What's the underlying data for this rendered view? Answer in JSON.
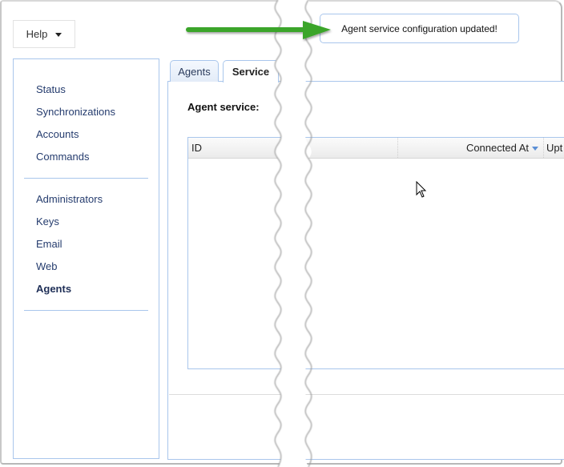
{
  "header": {
    "help_label": "Help"
  },
  "sidebar": {
    "groups": [
      {
        "items": [
          {
            "label": "Status",
            "active": false
          },
          {
            "label": "Synchronizations",
            "active": false
          },
          {
            "label": "Accounts",
            "active": false
          },
          {
            "label": "Commands",
            "active": false
          }
        ]
      },
      {
        "items": [
          {
            "label": "Administrators",
            "active": false
          },
          {
            "label": "Keys",
            "active": false
          },
          {
            "label": "Email",
            "active": false
          },
          {
            "label": "Web",
            "active": false
          },
          {
            "label": "Agents",
            "active": true
          }
        ]
      }
    ]
  },
  "main": {
    "tabs": [
      {
        "label": "Agents",
        "selected": false
      },
      {
        "label": "Service",
        "selected": true
      }
    ],
    "section_label": "Agent service:",
    "grid": {
      "columns": [
        {
          "label": "ID"
        },
        {
          "label": "Connected At",
          "sorted": "desc"
        },
        {
          "label": "Upt"
        }
      ],
      "rows": []
    }
  },
  "notification": {
    "message": "Agent service configuration updated!"
  },
  "annotation": {
    "arrow_color": "#3aa52a"
  }
}
